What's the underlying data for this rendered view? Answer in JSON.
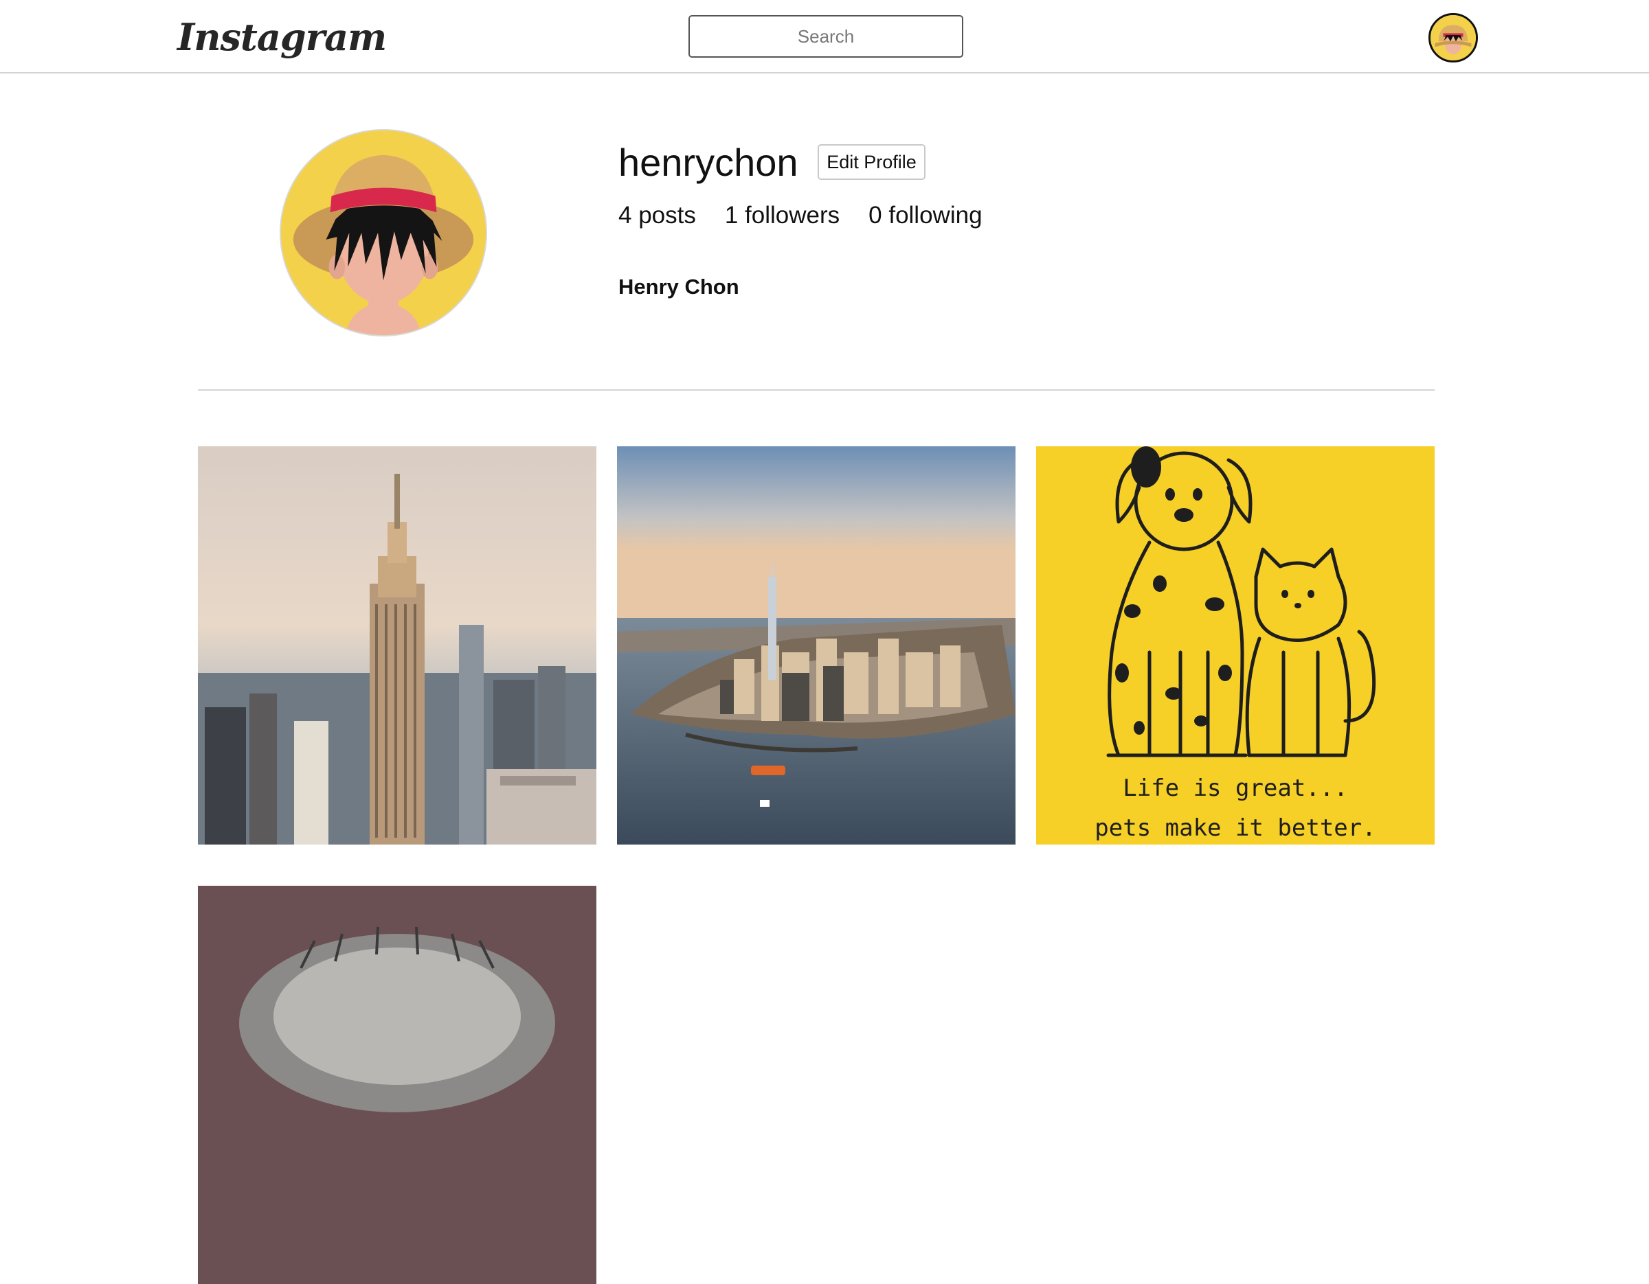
{
  "header": {
    "logo": "Instagram",
    "search_placeholder": "Search"
  },
  "profile": {
    "username": "henrychon",
    "edit_label": "Edit Profile",
    "posts_label": "4 posts",
    "followers_label": "1 followers",
    "following_label": "0 following",
    "full_name": "Henry Chon"
  },
  "posts": [
    {
      "caption": ""
    },
    {
      "caption": ""
    },
    {
      "caption_line1": "Life is great...",
      "caption_line2": "pets make it better."
    },
    {
      "caption": ""
    }
  ],
  "colors": {
    "avatar_bg": "#f3d14a",
    "hat": "#dcae64",
    "hat_band": "#d8294d",
    "skin": "#efb49f",
    "poster_bg": "#f6cf27"
  }
}
